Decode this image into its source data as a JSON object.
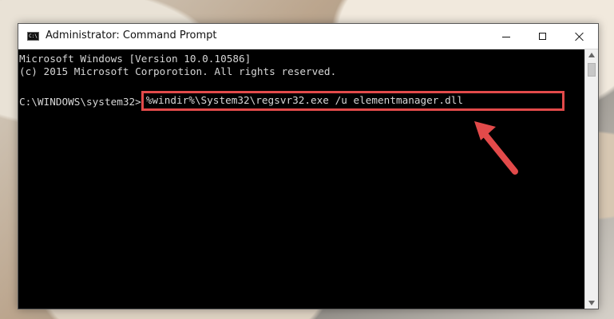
{
  "window": {
    "title": "Administrator: Command Prompt",
    "icon_label": "C:\\",
    "controls": {
      "minimize_icon": "minimize-icon",
      "maximize_icon": "maximize-icon",
      "close_icon": "close-icon"
    }
  },
  "console": {
    "line1": "Microsoft Windows [Version 10.0.10586]",
    "line2": "(c) 2015 Microsoft Corporotion. All rights reserved.",
    "prompt": "C:\\WINDOWS\\system32>",
    "command": "%windir%\\System32\\regsvr32.exe /u elementmanager.dll"
  },
  "annotation": {
    "highlight_color": "#e24a4a",
    "arrow_color": "#e24a4a"
  }
}
